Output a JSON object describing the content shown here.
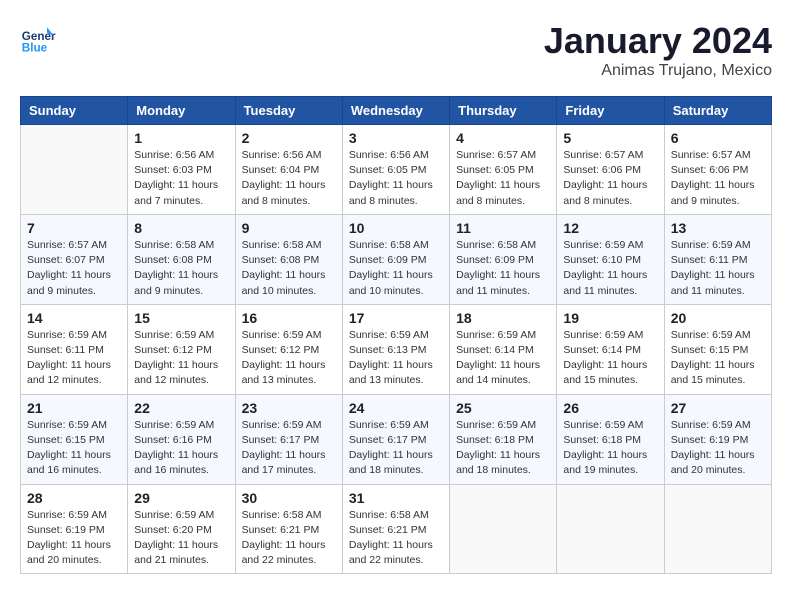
{
  "header": {
    "logo_line1": "General",
    "logo_line2": "Blue",
    "month": "January 2024",
    "location": "Animas Trujano, Mexico"
  },
  "days_of_week": [
    "Sunday",
    "Monday",
    "Tuesday",
    "Wednesday",
    "Thursday",
    "Friday",
    "Saturday"
  ],
  "weeks": [
    [
      {
        "day": "",
        "info": ""
      },
      {
        "day": "1",
        "info": "Sunrise: 6:56 AM\nSunset: 6:03 PM\nDaylight: 11 hours\nand 7 minutes."
      },
      {
        "day": "2",
        "info": "Sunrise: 6:56 AM\nSunset: 6:04 PM\nDaylight: 11 hours\nand 8 minutes."
      },
      {
        "day": "3",
        "info": "Sunrise: 6:56 AM\nSunset: 6:05 PM\nDaylight: 11 hours\nand 8 minutes."
      },
      {
        "day": "4",
        "info": "Sunrise: 6:57 AM\nSunset: 6:05 PM\nDaylight: 11 hours\nand 8 minutes."
      },
      {
        "day": "5",
        "info": "Sunrise: 6:57 AM\nSunset: 6:06 PM\nDaylight: 11 hours\nand 8 minutes."
      },
      {
        "day": "6",
        "info": "Sunrise: 6:57 AM\nSunset: 6:06 PM\nDaylight: 11 hours\nand 9 minutes."
      }
    ],
    [
      {
        "day": "7",
        "info": "Sunrise: 6:57 AM\nSunset: 6:07 PM\nDaylight: 11 hours\nand 9 minutes."
      },
      {
        "day": "8",
        "info": "Sunrise: 6:58 AM\nSunset: 6:08 PM\nDaylight: 11 hours\nand 9 minutes."
      },
      {
        "day": "9",
        "info": "Sunrise: 6:58 AM\nSunset: 6:08 PM\nDaylight: 11 hours\nand 10 minutes."
      },
      {
        "day": "10",
        "info": "Sunrise: 6:58 AM\nSunset: 6:09 PM\nDaylight: 11 hours\nand 10 minutes."
      },
      {
        "day": "11",
        "info": "Sunrise: 6:58 AM\nSunset: 6:09 PM\nDaylight: 11 hours\nand 11 minutes."
      },
      {
        "day": "12",
        "info": "Sunrise: 6:59 AM\nSunset: 6:10 PM\nDaylight: 11 hours\nand 11 minutes."
      },
      {
        "day": "13",
        "info": "Sunrise: 6:59 AM\nSunset: 6:11 PM\nDaylight: 11 hours\nand 11 minutes."
      }
    ],
    [
      {
        "day": "14",
        "info": "Sunrise: 6:59 AM\nSunset: 6:11 PM\nDaylight: 11 hours\nand 12 minutes."
      },
      {
        "day": "15",
        "info": "Sunrise: 6:59 AM\nSunset: 6:12 PM\nDaylight: 11 hours\nand 12 minutes."
      },
      {
        "day": "16",
        "info": "Sunrise: 6:59 AM\nSunset: 6:12 PM\nDaylight: 11 hours\nand 13 minutes."
      },
      {
        "day": "17",
        "info": "Sunrise: 6:59 AM\nSunset: 6:13 PM\nDaylight: 11 hours\nand 13 minutes."
      },
      {
        "day": "18",
        "info": "Sunrise: 6:59 AM\nSunset: 6:14 PM\nDaylight: 11 hours\nand 14 minutes."
      },
      {
        "day": "19",
        "info": "Sunrise: 6:59 AM\nSunset: 6:14 PM\nDaylight: 11 hours\nand 15 minutes."
      },
      {
        "day": "20",
        "info": "Sunrise: 6:59 AM\nSunset: 6:15 PM\nDaylight: 11 hours\nand 15 minutes."
      }
    ],
    [
      {
        "day": "21",
        "info": "Sunrise: 6:59 AM\nSunset: 6:15 PM\nDaylight: 11 hours\nand 16 minutes."
      },
      {
        "day": "22",
        "info": "Sunrise: 6:59 AM\nSunset: 6:16 PM\nDaylight: 11 hours\nand 16 minutes."
      },
      {
        "day": "23",
        "info": "Sunrise: 6:59 AM\nSunset: 6:17 PM\nDaylight: 11 hours\nand 17 minutes."
      },
      {
        "day": "24",
        "info": "Sunrise: 6:59 AM\nSunset: 6:17 PM\nDaylight: 11 hours\nand 18 minutes."
      },
      {
        "day": "25",
        "info": "Sunrise: 6:59 AM\nSunset: 6:18 PM\nDaylight: 11 hours\nand 18 minutes."
      },
      {
        "day": "26",
        "info": "Sunrise: 6:59 AM\nSunset: 6:18 PM\nDaylight: 11 hours\nand 19 minutes."
      },
      {
        "day": "27",
        "info": "Sunrise: 6:59 AM\nSunset: 6:19 PM\nDaylight: 11 hours\nand 20 minutes."
      }
    ],
    [
      {
        "day": "28",
        "info": "Sunrise: 6:59 AM\nSunset: 6:19 PM\nDaylight: 11 hours\nand 20 minutes."
      },
      {
        "day": "29",
        "info": "Sunrise: 6:59 AM\nSunset: 6:20 PM\nDaylight: 11 hours\nand 21 minutes."
      },
      {
        "day": "30",
        "info": "Sunrise: 6:58 AM\nSunset: 6:21 PM\nDaylight: 11 hours\nand 22 minutes."
      },
      {
        "day": "31",
        "info": "Sunrise: 6:58 AM\nSunset: 6:21 PM\nDaylight: 11 hours\nand 22 minutes."
      },
      {
        "day": "",
        "info": ""
      },
      {
        "day": "",
        "info": ""
      },
      {
        "day": "",
        "info": ""
      }
    ]
  ]
}
